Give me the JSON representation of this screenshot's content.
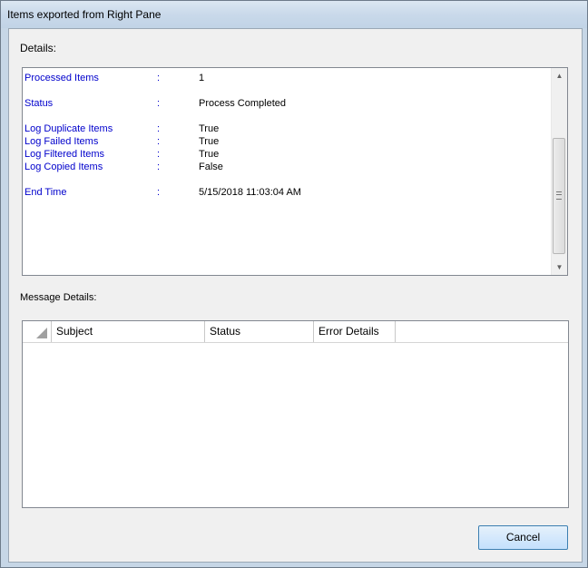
{
  "window": {
    "title": "Items exported from Right Pane"
  },
  "details": {
    "label": "Details:",
    "rows": [
      {
        "key": "Processed Items",
        "sep": ":",
        "value": "1"
      },
      {
        "key": "Status",
        "sep": ":",
        "value": "Process Completed"
      },
      {
        "key": "Log Duplicate Items",
        "sep": ":",
        "value": "True"
      },
      {
        "key": "Log Failed Items",
        "sep": ":",
        "value": "True"
      },
      {
        "key": "Log Filtered Items",
        "sep": ":",
        "value": "True"
      },
      {
        "key": "Log Copied Items",
        "sep": ":",
        "value": "False"
      },
      {
        "key": "End Time",
        "sep": ":",
        "value": "5/15/2018 11:03:04 AM"
      }
    ],
    "scroll_up_icon": "▲",
    "scroll_down_icon": "▼"
  },
  "message_details": {
    "label": "Message Details:",
    "columns": [
      "Subject",
      "Status",
      "Error Details"
    ],
    "rows": []
  },
  "buttons": {
    "cancel": "Cancel"
  }
}
